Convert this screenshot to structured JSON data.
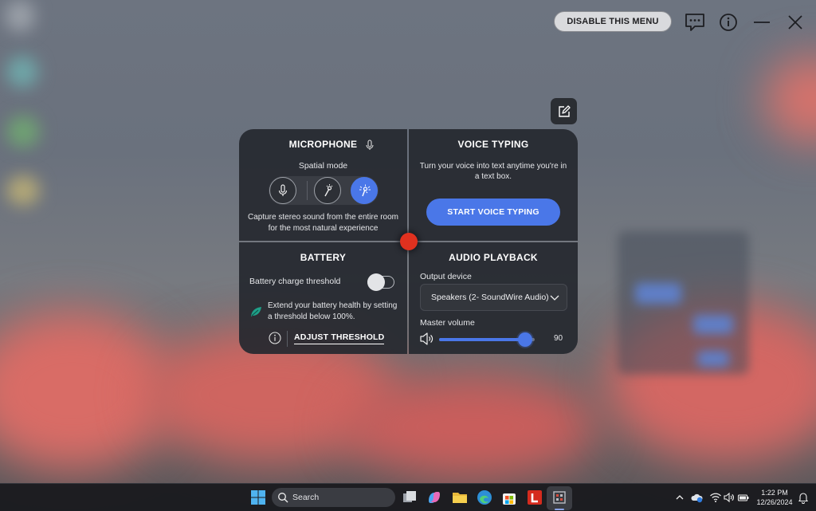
{
  "topbar": {
    "disable_label": "DISABLE THIS MENU",
    "icons": [
      "feedback-icon",
      "info-icon",
      "minimize-icon",
      "close-icon"
    ]
  },
  "microphone": {
    "title": "MICROPHONE",
    "spatial_label": "Spatial mode",
    "modes": [
      "mic-icon",
      "directional-mic-icon",
      "room-mic-icon"
    ],
    "active_mode": 2,
    "description": "Capture stereo sound from the entire room for the most natural experience"
  },
  "voice_typing": {
    "title": "VOICE TYPING",
    "description": "Turn your voice into text anytime you're in a text box.",
    "button_label": "START VOICE TYPING"
  },
  "battery": {
    "title": "BATTERY",
    "threshold_label": "Battery charge threshold",
    "toggle_on": false,
    "description": "Extend your battery health by setting a threshold below 100%.",
    "adjust_label": "ADJUST THRESHOLD"
  },
  "audio": {
    "title": "AUDIO PLAYBACK",
    "output_label": "Output device",
    "output_value": "Speakers (2- SoundWire Audio)",
    "volume_label": "Master volume",
    "volume": 90
  },
  "taskbar": {
    "search_placeholder": "Search",
    "apps": [
      "windows-start-icon",
      "task-view-icon",
      "copilot-icon",
      "file-explorer-icon",
      "edge-icon",
      "store-icon",
      "l-app-icon",
      "active-app-icon"
    ],
    "time": "1:22 PM",
    "date": "12/26/2024"
  },
  "colors": {
    "accent": "#4a77e8",
    "panel": "#26292f",
    "dot": "#e0311f"
  }
}
